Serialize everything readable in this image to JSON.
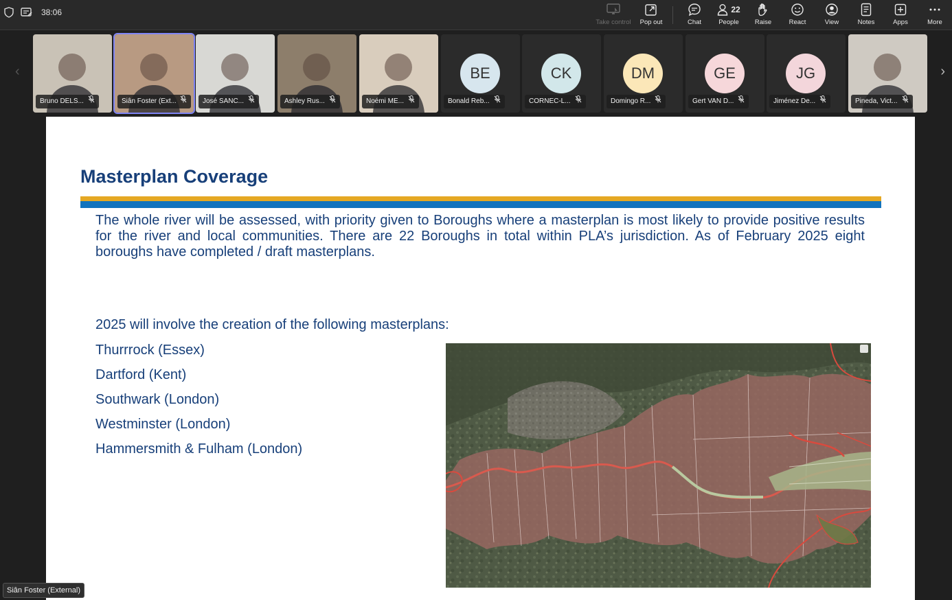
{
  "topbar": {
    "timer": "38:06",
    "buttons": [
      {
        "icon": "take-control-icon",
        "label": "Take control"
      },
      {
        "icon": "pop-out-icon",
        "label": "Pop out"
      },
      {
        "icon": "chat-icon",
        "label": "Chat"
      },
      {
        "icon": "people-icon",
        "label": "People",
        "count": "22"
      },
      {
        "icon": "raise-hand-icon",
        "label": "Raise"
      },
      {
        "icon": "react-icon",
        "label": "React"
      },
      {
        "icon": "view-icon",
        "label": "View"
      },
      {
        "icon": "notes-icon",
        "label": "Notes"
      },
      {
        "icon": "apps-icon",
        "label": "Apps"
      },
      {
        "icon": "more-icon",
        "label": "More"
      }
    ]
  },
  "participants": [
    {
      "name": "Bruno DELS...",
      "type": "video",
      "bg": "#c9c2b6",
      "active": false
    },
    {
      "name": "Siân Foster (Ext...",
      "type": "video",
      "bg": "#b89a82",
      "active": true
    },
    {
      "name": "José SANC...",
      "type": "video",
      "bg": "#d8d8d4",
      "active": false
    },
    {
      "name": "Ashley Rus...",
      "type": "video",
      "bg": "#8d7e6b",
      "active": false
    },
    {
      "name": "Noémi ME...",
      "type": "video",
      "bg": "#d9cdbd",
      "active": false
    },
    {
      "name": "Bonald Reb...",
      "type": "avatar",
      "initials": "BE",
      "color": "#d7e6ee",
      "active": false
    },
    {
      "name": "CORNEC-L...",
      "type": "avatar",
      "initials": "CK",
      "color": "#d2e7ea",
      "active": false
    },
    {
      "name": "Domingo R...",
      "type": "avatar",
      "initials": "DM",
      "color": "#fbe7b8",
      "active": false
    },
    {
      "name": "Gert VAN D...",
      "type": "avatar",
      "initials": "GE",
      "color": "#f6d7da",
      "active": false
    },
    {
      "name": "Jiménez De...",
      "type": "avatar",
      "initials": "JG",
      "color": "#f3d6db",
      "active": false
    },
    {
      "name": "Pineda, Vict...",
      "type": "video",
      "bg": "#cfcac2",
      "active": false
    }
  ],
  "slide": {
    "title": "Masterplan Coverage",
    "paragraph": "The whole river will be assessed, with priority given to Boroughs where a masterplan is most likely to provide positive results for the river and local communities. There are 22 Boroughs in total within PLA’s jurisdiction. As of February 2025 eight boroughs have completed / draft masterplans.",
    "intro": "2025 will involve the creation of the following masterplans:",
    "masterplans": [
      "Thurrrock (Essex)",
      "Dartford (Kent)",
      "Southwark (London)",
      "Westminster (London)",
      "Hammersmith & Fulham (London)"
    ]
  },
  "speaker_label": "Siân Foster (External)",
  "colors": {
    "title_blue": "#173f79",
    "bar_gold": "#e5a823",
    "bar_blue": "#1273bd",
    "active_outline": "#7f85f5"
  }
}
